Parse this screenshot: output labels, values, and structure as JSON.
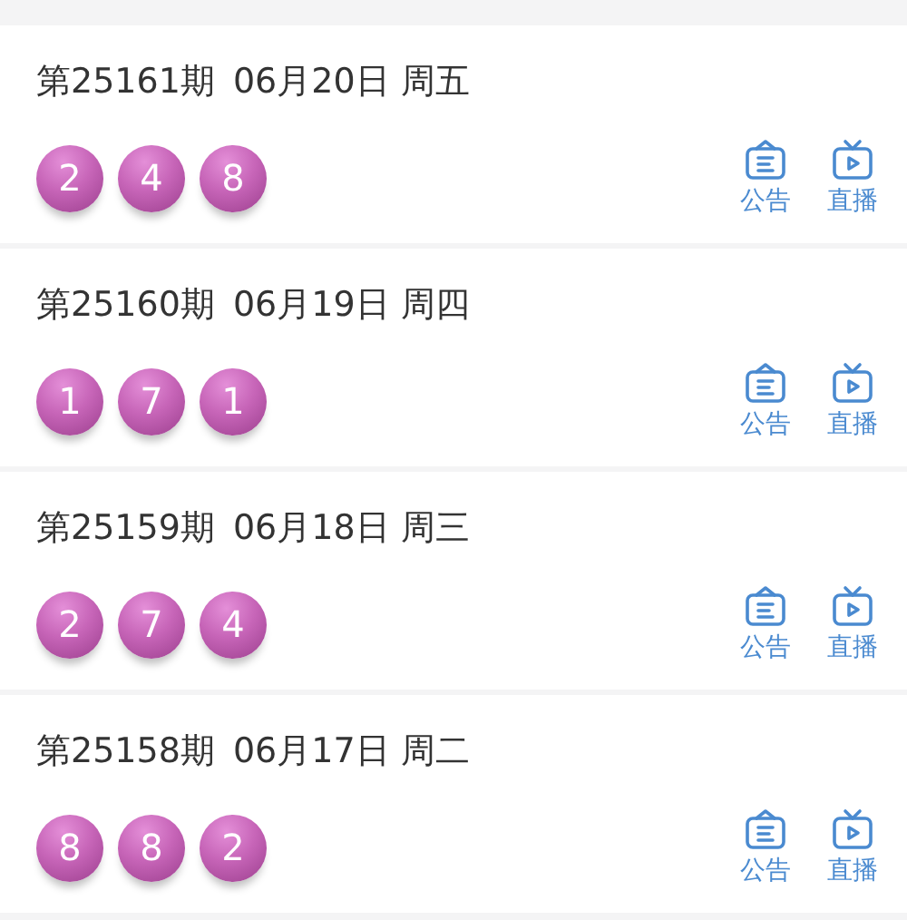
{
  "draws": [
    {
      "issue": "第25161期",
      "date": "06月20日",
      "weekday": "周五",
      "balls": [
        "2",
        "4",
        "8"
      ],
      "actions": [
        {
          "kind": "notice",
          "label": "公告"
        },
        {
          "kind": "live",
          "label": "直播"
        }
      ]
    },
    {
      "issue": "第25160期",
      "date": "06月19日",
      "weekday": "周四",
      "balls": [
        "1",
        "7",
        "1"
      ],
      "actions": [
        {
          "kind": "notice",
          "label": "公告"
        },
        {
          "kind": "live",
          "label": "直播"
        }
      ]
    },
    {
      "issue": "第25159期",
      "date": "06月18日",
      "weekday": "周三",
      "balls": [
        "2",
        "7",
        "4"
      ],
      "actions": [
        {
          "kind": "notice",
          "label": "公告"
        },
        {
          "kind": "live",
          "label": "直播"
        }
      ]
    },
    {
      "issue": "第25158期",
      "date": "06月17日",
      "weekday": "周二",
      "balls": [
        "8",
        "8",
        "2"
      ],
      "actions": [
        {
          "kind": "notice",
          "label": "公告"
        },
        {
          "kind": "live",
          "label": "直播"
        }
      ]
    }
  ]
}
